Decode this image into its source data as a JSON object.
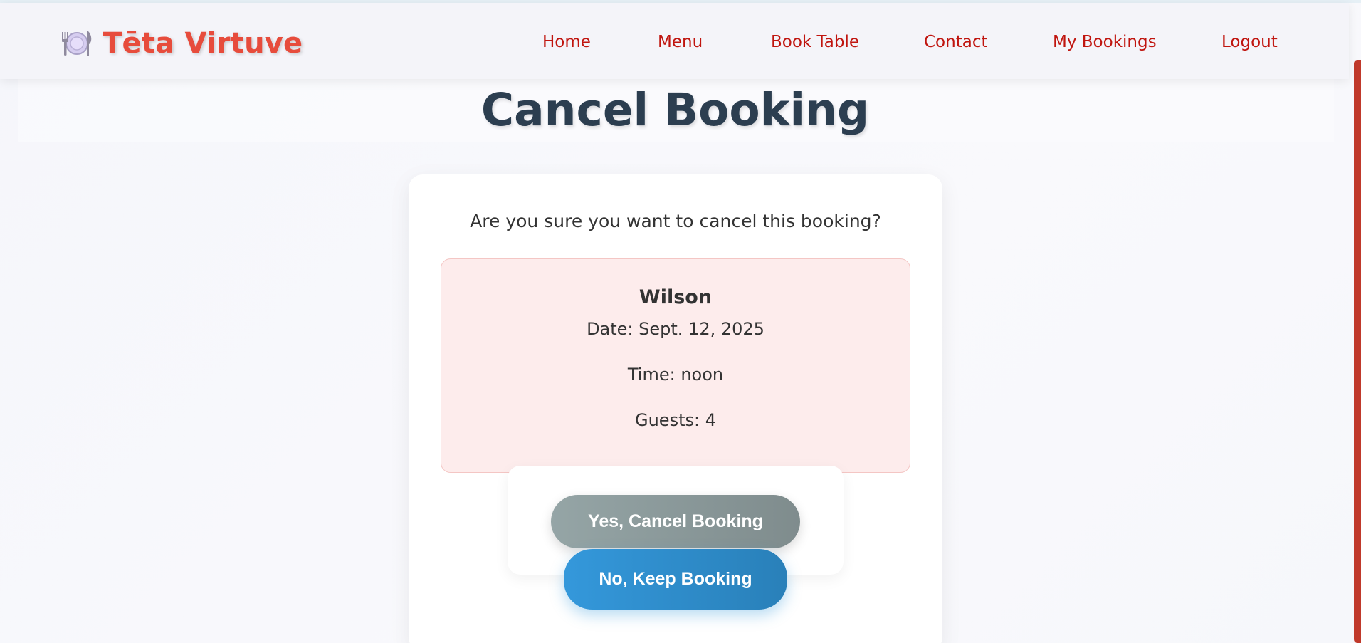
{
  "brand": {
    "name": "Tēta Virtuve",
    "icon": "plate-with-cutlery-icon"
  },
  "nav": [
    {
      "id": "home",
      "label": "Home"
    },
    {
      "id": "menu",
      "label": "Menu"
    },
    {
      "id": "book-table",
      "label": "Book Table"
    },
    {
      "id": "contact",
      "label": "Contact"
    },
    {
      "id": "my-bookings",
      "label": "My Bookings"
    },
    {
      "id": "logout",
      "label": "Logout"
    }
  ],
  "page": {
    "title": "Cancel Booking"
  },
  "confirm": {
    "question": "Are you sure you want to cancel this booking?",
    "booking": {
      "name": "Wilson",
      "date": "Date: Sept. 12, 2025",
      "time": "Time: noon",
      "guests": "Guests: 4"
    },
    "yes_label": "Yes, Cancel Booking",
    "no_label": "No, Keep Booking"
  },
  "colors": {
    "brand": "#e74c3c",
    "nav_link": "#c0150f",
    "title": "#2c3e50",
    "details_bg": "#fdecec",
    "yes_button": "#95a5a6",
    "no_button": "#3498db",
    "scrollbar": "#c0392b"
  }
}
